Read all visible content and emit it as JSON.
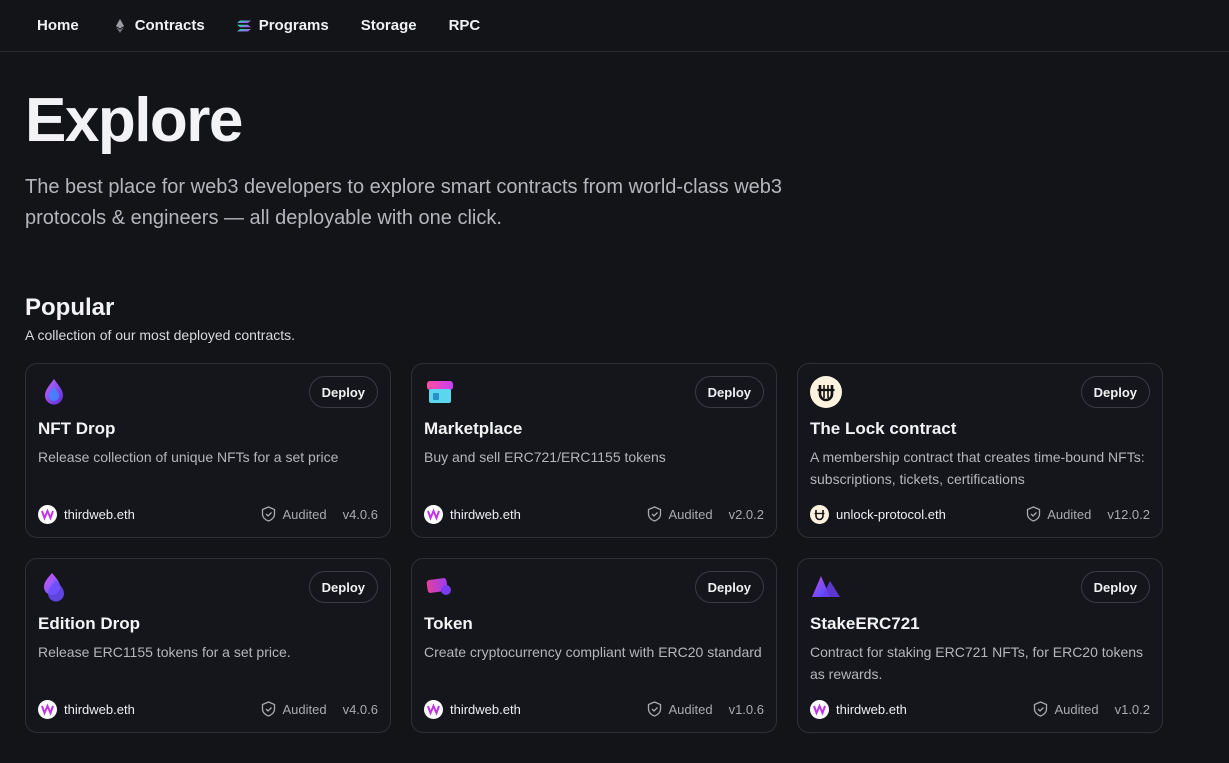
{
  "nav": {
    "items": [
      {
        "label": "Home",
        "icon": ""
      },
      {
        "label": "Contracts",
        "icon": "ethereum-icon"
      },
      {
        "label": "Programs",
        "icon": "solana-icon"
      },
      {
        "label": "Storage",
        "icon": ""
      },
      {
        "label": "RPC",
        "icon": ""
      }
    ]
  },
  "hero": {
    "title": "Explore",
    "subtitle": "The best place for web3 developers to explore smart contracts from world-class web3 protocols & engineers — all deployable with one click."
  },
  "section": {
    "title": "Popular",
    "subtitle": "A collection of our most deployed contracts."
  },
  "cards": [
    {
      "title": "NFT Drop",
      "description": "Release collection of unique NFTs for a set price",
      "author": "thirdweb.eth",
      "audited": "Audited",
      "version": "v4.0.6",
      "deploy": "Deploy",
      "logo": "nft-drop-icon"
    },
    {
      "title": "Marketplace",
      "description": "Buy and sell ERC721/ERC1155 tokens",
      "author": "thirdweb.eth",
      "audited": "Audited",
      "version": "v2.0.2",
      "deploy": "Deploy",
      "logo": "marketplace-icon"
    },
    {
      "title": "The Lock contract",
      "description": "A membership contract that creates time-bound NFTs: subscriptions, tickets, certifications",
      "author": "unlock-protocol.eth",
      "audited": "Audited",
      "version": "v12.0.2",
      "deploy": "Deploy",
      "logo": "unlock-icon"
    },
    {
      "title": "Edition Drop",
      "description": "Release ERC1155 tokens for a set price.",
      "author": "thirdweb.eth",
      "audited": "Audited",
      "version": "v4.0.6",
      "deploy": "Deploy",
      "logo": "edition-drop-icon"
    },
    {
      "title": "Token",
      "description": "Create cryptocurrency compliant with ERC20 standard",
      "author": "thirdweb.eth",
      "audited": "Audited",
      "version": "v1.0.6",
      "deploy": "Deploy",
      "logo": "token-icon"
    },
    {
      "title": "StakeERC721",
      "description": "Contract for staking ERC721 NFTs, for ERC20 tokens as rewards.",
      "author": "thirdweb.eth",
      "audited": "Audited",
      "version": "v1.0.2",
      "deploy": "Deploy",
      "logo": "stake-icon"
    }
  ],
  "colors": {
    "background": "#131418",
    "card_border": "#2e3037",
    "text_muted": "#b5b6bc"
  }
}
